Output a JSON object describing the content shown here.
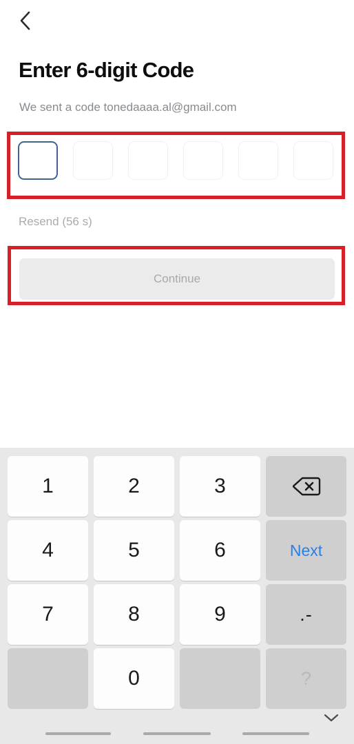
{
  "header": {
    "back_icon": "chevron-left-icon",
    "title": "Enter 6-digit Code",
    "subtitle": "We sent a code tonedaaaa.al@gmail.com"
  },
  "otp": {
    "length": 6,
    "focused_index": 0,
    "values": [
      "",
      "",
      "",
      "",
      "",
      ""
    ],
    "focus_border_color": "#3f6493",
    "idle_border_color": "#f0f1f3"
  },
  "resend": {
    "label": "Resend (56 s)",
    "seconds": 56,
    "color": "#a8abaf"
  },
  "primary_action": {
    "label": "Continue",
    "enabled": false,
    "background": "#ebebeb",
    "text_color": "#a9a9a9"
  },
  "annotations": {
    "color": "#d61f26",
    "boxes": [
      {
        "name": "otp-input-row-highlight"
      },
      {
        "name": "continue-button-highlight"
      }
    ]
  },
  "keyboard": {
    "type": "numeric",
    "background": "#e8e8e9",
    "accent_color": "#2b7fe8",
    "keys": [
      {
        "label": "1",
        "kind": "num",
        "name": "key-1"
      },
      {
        "label": "2",
        "kind": "num",
        "name": "key-2"
      },
      {
        "label": "3",
        "kind": "num",
        "name": "key-3"
      },
      {
        "label": "",
        "kind": "fn",
        "name": "backspace-key",
        "icon": "backspace-icon"
      },
      {
        "label": "4",
        "kind": "num",
        "name": "key-4"
      },
      {
        "label": "5",
        "kind": "num",
        "name": "key-5"
      },
      {
        "label": "6",
        "kind": "num",
        "name": "key-6"
      },
      {
        "label": "Next",
        "kind": "next",
        "name": "next-key"
      },
      {
        "label": "7",
        "kind": "num",
        "name": "key-7"
      },
      {
        "label": "8",
        "kind": "num",
        "name": "key-8"
      },
      {
        "label": "9",
        "kind": "num",
        "name": "key-9"
      },
      {
        "label": ".-",
        "kind": "dotdash",
        "name": "key-dot-dash"
      },
      {
        "label": "",
        "kind": "blank",
        "name": "key-blank-left"
      },
      {
        "label": "0",
        "kind": "num",
        "name": "key-0"
      },
      {
        "label": "",
        "kind": "blank",
        "name": "key-blank-right"
      },
      {
        "label": "?",
        "kind": "qmark",
        "name": "key-question-mark"
      }
    ]
  },
  "navbar": {
    "hide_keyboard_icon": "chevron-down-icon",
    "gesture_hints": 3
  }
}
